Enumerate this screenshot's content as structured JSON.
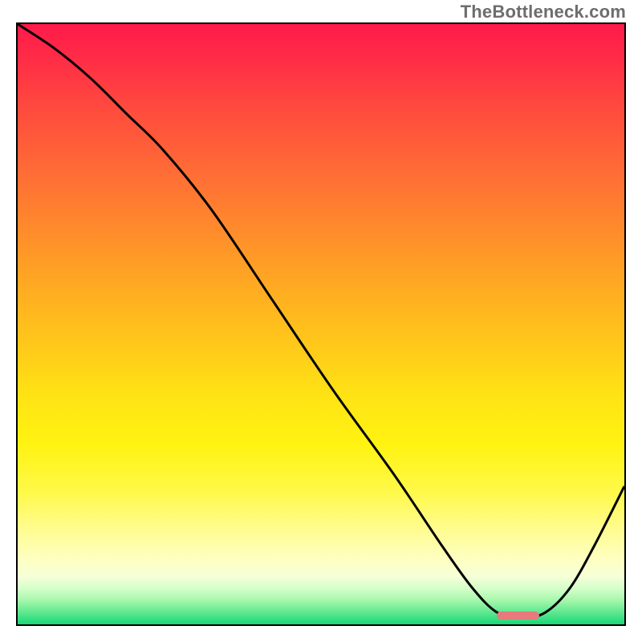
{
  "attribution": "TheBottleneck.com",
  "colors": {
    "curve_stroke": "#000000",
    "minimum_band": "#e77a7d",
    "border": "#000000"
  },
  "chart_data": {
    "type": "line",
    "title": "",
    "xlabel": "",
    "ylabel": "",
    "xlim": [
      0,
      100
    ],
    "ylim": [
      0,
      100
    ],
    "grid": false,
    "legend": false,
    "x": [
      0,
      6,
      12,
      18,
      24,
      32,
      42,
      52,
      62,
      70,
      75,
      79,
      83,
      87,
      91,
      95,
      100
    ],
    "values": [
      100,
      96,
      91,
      85,
      79,
      69,
      54,
      39,
      25,
      13,
      6,
      2,
      1,
      2,
      6,
      13,
      23
    ],
    "minimum_band_x": [
      79,
      86
    ]
  }
}
